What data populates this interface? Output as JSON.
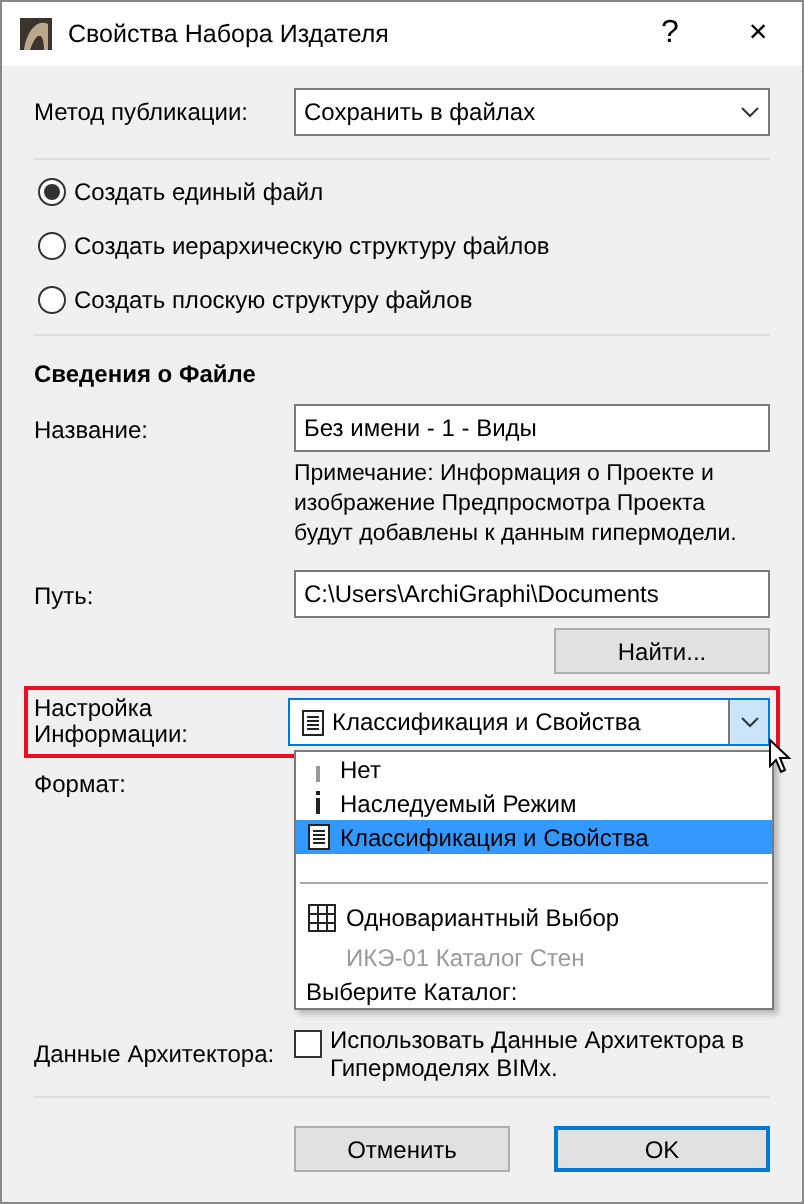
{
  "window": {
    "title": "Свойства Набора Издателя",
    "help": "?",
    "close": "×"
  },
  "method": {
    "label": "Метод публикации:",
    "value": "Сохранить в файлах"
  },
  "structure": [
    {
      "label": "Создать единый файл",
      "selected": true
    },
    {
      "label": "Создать иерархическую структуру файлов",
      "selected": false
    },
    {
      "label": "Создать плоскую структуру файлов",
      "selected": false
    }
  ],
  "file_info": {
    "heading": "Сведения о Файле",
    "name_label": "Название:",
    "name_value": "Без имени - 1 - Виды",
    "note": "Примечание: Информация о Проекте и изображение Предпросмотра Проекта будут добавлены к данным гипермодели.",
    "path_label": "Путь:",
    "path_value": "C:\\Users\\ArchiGraphi\\Documents",
    "browse": "Найти..."
  },
  "info_setting": {
    "label": "Настройка Информации:",
    "value": "Классификация и Свойства",
    "highlighted": true,
    "expanded": true,
    "options": [
      {
        "kind": "faint-i",
        "label": "Нет",
        "selected": false,
        "disabled": false
      },
      {
        "kind": "i",
        "label": "Наследуемый Режим",
        "selected": false,
        "disabled": false
      },
      {
        "kind": "doc",
        "label": "Классификация и Свойства",
        "selected": true,
        "disabled": false
      },
      {
        "kind": "separator"
      },
      {
        "kind": "table",
        "label": "Одновариантный Выбор",
        "selected": false,
        "disabled": false
      },
      {
        "kind": "sub",
        "label": "ИКЭ-01 Каталог Стен",
        "selected": false,
        "disabled": true
      },
      {
        "kind": "caption",
        "label": "Выберите Каталог:",
        "selected": false,
        "disabled": false
      }
    ]
  },
  "format": {
    "label": "Формат:"
  },
  "architect": {
    "label": "Данные Архитектора:",
    "checkbox": "Использовать Данные Архитектора в Гипермоделях BIMx.",
    "checked": false
  },
  "buttons": [
    {
      "label": "Отменить",
      "default": false
    },
    {
      "label": "OK",
      "default": true
    }
  ]
}
